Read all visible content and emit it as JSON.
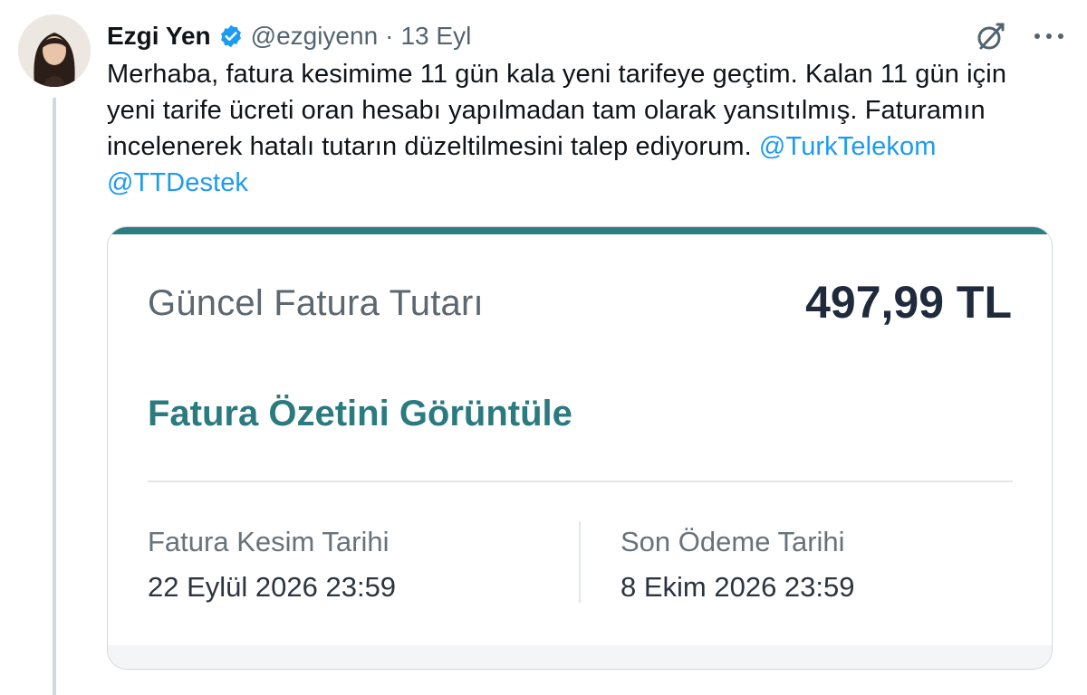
{
  "tweet": {
    "author": {
      "display_name": "Ezgi Yen",
      "handle": "@ezgiyenn",
      "verified": true
    },
    "separator": "·",
    "date": "13 Eyl",
    "text_line1": "Merhaba, fatura kesimime 11 gün kala yeni tarifeye geçtim. Kalan 11 gün için",
    "text_line2": "yeni tarife ücreti oran hesabı yapılmadan tam olarak yansıtılmış. Faturamın",
    "text_line3": "incelenerek hatalı tutarın düzeltilmesini talep ediyorum.",
    "mention1": "@TurkTelekom",
    "mention2": "@TTDestek",
    "icons": {
      "verified": "verified-badge-icon",
      "grok": "grok-icon",
      "more": "more-icon"
    },
    "colors": {
      "mention": "#1d9bf0",
      "verified": "#1d9bf0"
    }
  },
  "card": {
    "amount_label": "Güncel Fatura Tutarı",
    "amount_value": "497,99 TL",
    "summary_link": "Fatura Özetini Görüntüle",
    "left_label": "Fatura Kesim Tarihi",
    "left_value": "22 Eylül 2026 23:59",
    "right_label": "Son Ödeme Tarihi",
    "right_value": "8 Ekim 2026 23:59",
    "colors": {
      "accent": "#2e7d83",
      "amount": "#1f2a3c"
    }
  }
}
